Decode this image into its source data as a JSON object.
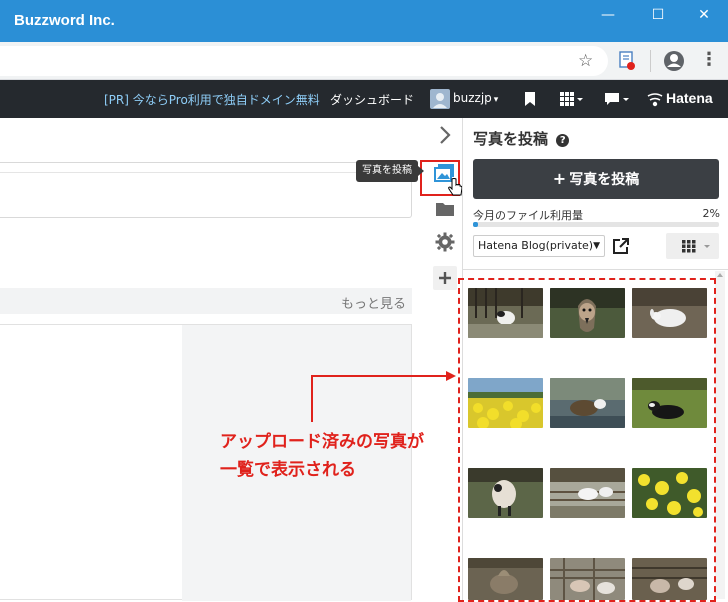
{
  "window": {
    "title": "Buzzword Inc.",
    "minimize_glyph": "—",
    "maximize_glyph": "☐",
    "close_glyph": "✕"
  },
  "browser": {
    "star_icon": "☆",
    "menu_glyph": "⋮"
  },
  "nav": {
    "promo": "[PR] 今ならPro利用で独自ドメイン無料",
    "dashboard": "ダッシュボード",
    "username": "buzzjp",
    "caret": "▾",
    "brand": "Hatena"
  },
  "editor": {
    "more_link": "もっと見る"
  },
  "sidebar": {
    "tooltip": "写真を投稿",
    "title": "写真を投稿",
    "help_glyph": "?",
    "upload_button": "写真を投稿",
    "upload_plus": "+",
    "usage_label": "今月のファイル利用量",
    "usage_percent": "2%",
    "usage_fraction": 0.02,
    "blog_select": "Hatena Blog(private)",
    "select_caret": "▼"
  },
  "annotation": {
    "line1": "アップロード済みの写真が",
    "line2": "一覧で表示される",
    "color": "#e0221c"
  },
  "colors": {
    "titlebar": "#2b8fd6",
    "nav": "#25292e",
    "primary_button": "#3b3f44",
    "active_icon": "#2f94d8",
    "promo_link": "#8ecdf7"
  }
}
